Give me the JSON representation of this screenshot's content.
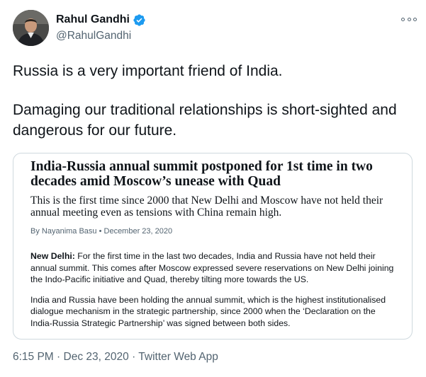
{
  "author": {
    "display_name": "Rahul Gandhi",
    "handle": "@RahulGandhi",
    "verified": true,
    "verified_icon": "verified-badge-icon",
    "more_icon": "more-options-icon"
  },
  "tweet": {
    "paragraphs": [
      "Russia is a very important friend of India.",
      "Damaging our traditional relationships is short-sighted and dangerous for our future."
    ]
  },
  "card": {
    "headline": "India-Russia annual summit postponed for 1st time in two decades amid Moscow’s unease with Quad",
    "standfirst": "This is the first time since 2000 that New Delhi and Moscow have not held their annual meeting even as tensions with China remain high.",
    "byline": "By Nayanima Basu • December 23, 2020",
    "dateline": "New Delhi:",
    "para1": "For the first time in the last two decades, India and Russia have not held their annual summit. This comes after Moscow expressed severe reservations on New Delhi joining the Indo-Pacific initiative and Quad, thereby tilting more towards the US.",
    "para2": "India and Russia have been holding the annual summit, which is the highest institutionalised dialogue mechanism in the strategic partnership, since 2000 when the ‘Declaration on the India-Russia Strategic Partnership’ was signed between both sides."
  },
  "meta": {
    "time": "6:15 PM",
    "separator": "·",
    "date": "Dec 23, 2020",
    "source": "Twitter Web App"
  },
  "colors": {
    "verified_blue": "#1d9bf0",
    "secondary_text": "#536471",
    "card_border": "#cfd9de"
  }
}
